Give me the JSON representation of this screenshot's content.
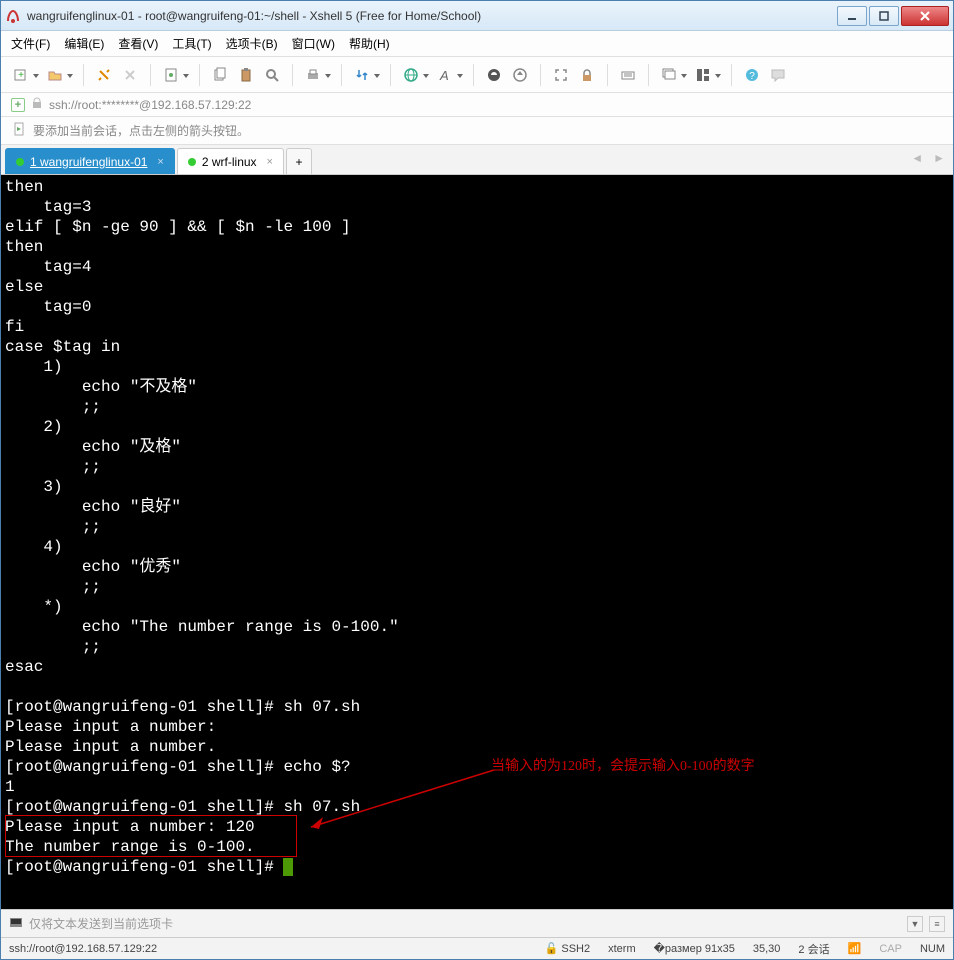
{
  "window": {
    "title": "wangruifenglinux-01 - root@wangruifeng-01:~/shell - Xshell 5 (Free for Home/School)"
  },
  "menu": {
    "file": "文件(F)",
    "edit": "编辑(E)",
    "view": "查看(V)",
    "tools": "工具(T)",
    "tabs": "选项卡(B)",
    "window": "窗口(W)",
    "help": "帮助(H)"
  },
  "addressbar": {
    "text": "ssh://root:********@192.168.57.129:22"
  },
  "hint": {
    "text": "要添加当前会话，点击左侧的箭头按钮。"
  },
  "tabs": {
    "t1": "1 wangruifenglinux-01",
    "t2": "2 wrf-linux"
  },
  "terminal": {
    "lines": [
      "then",
      "    tag=3",
      "elif [ $n -ge 90 ] && [ $n -le 100 ]",
      "then",
      "    tag=4",
      "else",
      "    tag=0",
      "fi",
      "case $tag in",
      "    1)",
      "        echo \"不及格\"",
      "        ;;",
      "    2)",
      "        echo \"及格\"",
      "        ;;",
      "    3)",
      "        echo \"良好\"",
      "        ;;",
      "    4)",
      "        echo \"优秀\"",
      "        ;;",
      "    *)",
      "        echo \"The number range is 0-100.\"",
      "        ;;",
      "esac",
      "",
      "[root@wangruifeng-01 shell]# sh 07.sh",
      "Please input a number:",
      "Please input a number.",
      "[root@wangruifeng-01 shell]# echo $?",
      "1",
      "[root@wangruifeng-01 shell]# sh 07.sh",
      "Please input a number: 120",
      "The number range is 0-100.",
      "[root@wangruifeng-01 shell]# "
    ],
    "annotation": "当输入的为120时，会提示输入0-100的数字"
  },
  "bottominput": {
    "placeholder": "仅将文本发送到当前选项卡"
  },
  "status": {
    "left": "ssh://root@192.168.57.129:22",
    "ssh": "SSH2",
    "term": "xterm",
    "size": "91x35",
    "pos": "35,30",
    "sess": "2 会话",
    "cap": "CAP",
    "num": "NUM"
  }
}
